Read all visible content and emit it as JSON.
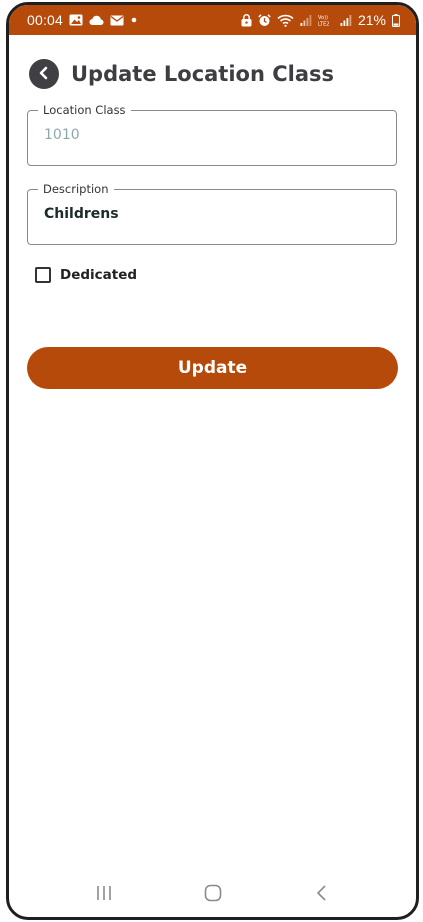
{
  "status_bar": {
    "time": "00:04",
    "battery": "21%",
    "left_icons": [
      "image-icon",
      "cloud-icon",
      "mail-icon",
      "dot-icon"
    ],
    "right_icons": [
      "lock-icon",
      "alarm-icon",
      "wifi-icon",
      "signal-icon",
      "volte-icon",
      "signal-icon",
      "battery-icon"
    ]
  },
  "header": {
    "title": "Update Location Class"
  },
  "form": {
    "location_class": {
      "label": "Location Class",
      "value": "1010"
    },
    "description": {
      "label": "Description",
      "value": "Childrens"
    },
    "dedicated": {
      "label": "Dedicated",
      "checked": false
    }
  },
  "actions": {
    "update_label": "Update"
  },
  "nav_bar": {
    "buttons": [
      "recents-icon",
      "home-icon",
      "back-icon"
    ]
  },
  "colors": {
    "accent": "#b54a0b",
    "title": "#3e3e42",
    "muted_value": "#8fa8ae"
  }
}
